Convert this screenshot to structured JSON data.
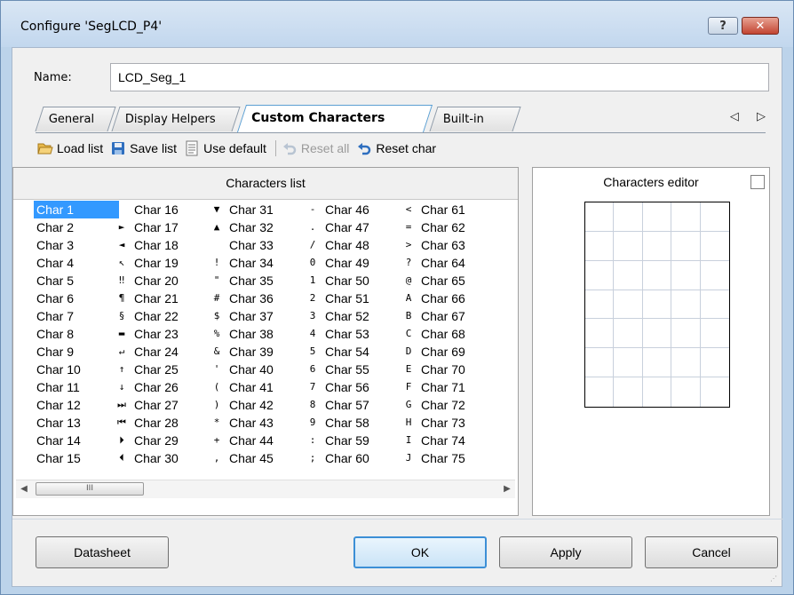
{
  "window": {
    "title": "Configure 'SegLCD_P4'",
    "help_label": "?",
    "close_label": "✕"
  },
  "name": {
    "label": "Name:",
    "value": "LCD_Seg_1"
  },
  "tabs": [
    {
      "label": "General"
    },
    {
      "label": "Display Helpers"
    },
    {
      "label": "Custom Characters",
      "active": true
    },
    {
      "label": "Built-in"
    }
  ],
  "tab_arrows": "◁ ▷",
  "toolbar": {
    "load_label": "Load list",
    "save_label": "Save list",
    "default_label": "Use default",
    "reset_all_label": "Reset all",
    "reset_char_label": "Reset char"
  },
  "list": {
    "header": "Characters list",
    "selected": "Char 1",
    "columns": [
      [
        {
          "glyph": "",
          "label": "Char 1"
        },
        {
          "glyph": "",
          "label": "Char 2"
        },
        {
          "glyph": "",
          "label": "Char 3"
        },
        {
          "glyph": "",
          "label": "Char 4"
        },
        {
          "glyph": "",
          "label": "Char 5"
        },
        {
          "glyph": "",
          "label": "Char 6"
        },
        {
          "glyph": "",
          "label": "Char 7"
        },
        {
          "glyph": "",
          "label": "Char 8"
        },
        {
          "glyph": "",
          "label": "Char 9"
        },
        {
          "glyph": "",
          "label": "Char 10"
        },
        {
          "glyph": "",
          "label": "Char 11"
        },
        {
          "glyph": "",
          "label": "Char 12"
        },
        {
          "glyph": "",
          "label": "Char 13"
        },
        {
          "glyph": "",
          "label": "Char 14"
        },
        {
          "glyph": "",
          "label": "Char 15"
        }
      ],
      [
        {
          "glyph": "",
          "label": "Char 16"
        },
        {
          "glyph": "►",
          "label": "Char 17"
        },
        {
          "glyph": "◄",
          "label": "Char 18"
        },
        {
          "glyph": "↖",
          "label": "Char 19"
        },
        {
          "glyph": "‼",
          "label": "Char 20"
        },
        {
          "glyph": "¶",
          "label": "Char 21"
        },
        {
          "glyph": "§",
          "label": "Char 22"
        },
        {
          "glyph": "▬",
          "label": "Char 23"
        },
        {
          "glyph": "↵",
          "label": "Char 24"
        },
        {
          "glyph": "↑",
          "label": "Char 25"
        },
        {
          "glyph": "↓",
          "label": "Char 26"
        },
        {
          "glyph": "⏭",
          "label": "Char 27"
        },
        {
          "glyph": "⏮",
          "label": "Char 28"
        },
        {
          "glyph": "⏵",
          "label": "Char 29"
        },
        {
          "glyph": "⏴",
          "label": "Char 30"
        }
      ],
      [
        {
          "glyph": "▼",
          "label": "Char 31"
        },
        {
          "glyph": "▲",
          "label": "Char 32"
        },
        {
          "glyph": "",
          "label": "Char 33"
        },
        {
          "glyph": "!",
          "label": "Char 34"
        },
        {
          "glyph": "\"",
          "label": "Char 35"
        },
        {
          "glyph": "#",
          "label": "Char 36"
        },
        {
          "glyph": "$",
          "label": "Char 37"
        },
        {
          "glyph": "%",
          "label": "Char 38"
        },
        {
          "glyph": "&",
          "label": "Char 39"
        },
        {
          "glyph": "'",
          "label": "Char 40"
        },
        {
          "glyph": "(",
          "label": "Char 41"
        },
        {
          "glyph": ")",
          "label": "Char 42"
        },
        {
          "glyph": "*",
          "label": "Char 43"
        },
        {
          "glyph": "+",
          "label": "Char 44"
        },
        {
          "glyph": ",",
          "label": "Char 45"
        }
      ],
      [
        {
          "glyph": "-",
          "label": "Char 46"
        },
        {
          "glyph": ".",
          "label": "Char 47"
        },
        {
          "glyph": "/",
          "label": "Char 48"
        },
        {
          "glyph": "0",
          "label": "Char 49"
        },
        {
          "glyph": "1",
          "label": "Char 50"
        },
        {
          "glyph": "2",
          "label": "Char 51"
        },
        {
          "glyph": "3",
          "label": "Char 52"
        },
        {
          "glyph": "4",
          "label": "Char 53"
        },
        {
          "glyph": "5",
          "label": "Char 54"
        },
        {
          "glyph": "6",
          "label": "Char 55"
        },
        {
          "glyph": "7",
          "label": "Char 56"
        },
        {
          "glyph": "8",
          "label": "Char 57"
        },
        {
          "glyph": "9",
          "label": "Char 58"
        },
        {
          "glyph": ":",
          "label": "Char 59"
        },
        {
          "glyph": ";",
          "label": "Char 60"
        }
      ],
      [
        {
          "glyph": "<",
          "label": "Char 61"
        },
        {
          "glyph": "=",
          "label": "Char 62"
        },
        {
          "glyph": ">",
          "label": "Char 63"
        },
        {
          "glyph": "?",
          "label": "Char 64"
        },
        {
          "glyph": "@",
          "label": "Char 65"
        },
        {
          "glyph": "A",
          "label": "Char 66"
        },
        {
          "glyph": "B",
          "label": "Char 67"
        },
        {
          "glyph": "C",
          "label": "Char 68"
        },
        {
          "glyph": "D",
          "label": "Char 69"
        },
        {
          "glyph": "E",
          "label": "Char 70"
        },
        {
          "glyph": "F",
          "label": "Char 71"
        },
        {
          "glyph": "G",
          "label": "Char 72"
        },
        {
          "glyph": "H",
          "label": "Char 73"
        },
        {
          "glyph": "I",
          "label": "Char 74"
        },
        {
          "glyph": "J",
          "label": "Char 75"
        }
      ]
    ],
    "scroll_thumb_label": "III"
  },
  "editor": {
    "header": "Characters editor",
    "rows": 7,
    "cols": 5
  },
  "buttons": {
    "datasheet_label": "Datasheet",
    "ok_label": "OK",
    "apply_label": "Apply",
    "cancel_label": "Cancel"
  },
  "colors": {
    "selection": "#3399ff",
    "active_tab_border": "#5b9fd3",
    "frame": "#bcd3ea"
  }
}
